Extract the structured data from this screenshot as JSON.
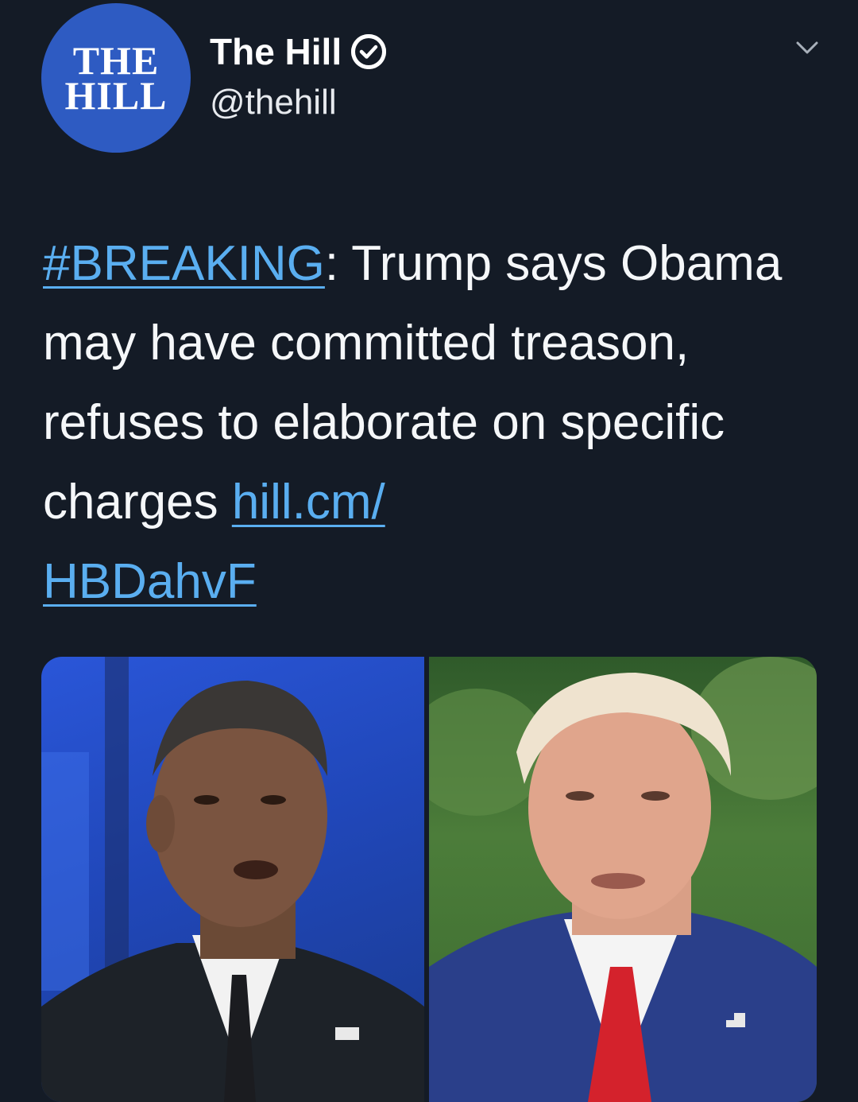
{
  "account": {
    "avatar_line1": "THE",
    "avatar_line2": "HILL",
    "display_name": "The Hill",
    "handle": "@thehill",
    "verified": true
  },
  "icons": {
    "verified": "verified-badge-icon",
    "menu": "chevron-down-icon"
  },
  "tweet": {
    "hashtag": "#BREAKING",
    "text_part1": ": Trump says Obama may have committed treason, refuses to elaborate on specific charges ",
    "link_part1": "hill.cm/",
    "link_part2": "HBDahvF"
  },
  "colors": {
    "background": "#141b26",
    "link": "#5aaef0",
    "avatar": "#2e5bc2",
    "text": "#f5f7f9"
  }
}
